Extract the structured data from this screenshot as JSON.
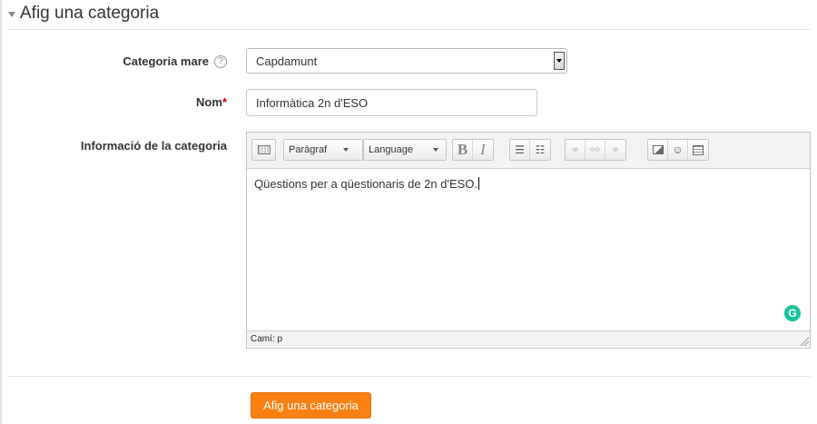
{
  "section": {
    "title": "Afig una categoria"
  },
  "fields": {
    "parent": {
      "label": "Categoria mare",
      "help": "?",
      "value": "Capdamunt"
    },
    "name": {
      "label": "Nom",
      "required_mark": "*",
      "value": "Informàtica 2n d'ESO"
    },
    "info": {
      "label": "Informació de la categoria"
    }
  },
  "editor": {
    "toolbar": {
      "paragraph": "Paràgraf",
      "language": "Language",
      "bold": "B",
      "italic": "I"
    },
    "content": "Qüestions per a qüestionaris de 2n d'ESO.",
    "status_path": "Camí: p"
  },
  "submit": {
    "label": "Afig una categoria"
  },
  "colors": {
    "accent": "#f98012",
    "required": "#cc0000",
    "grammarly": "#15c39a"
  }
}
